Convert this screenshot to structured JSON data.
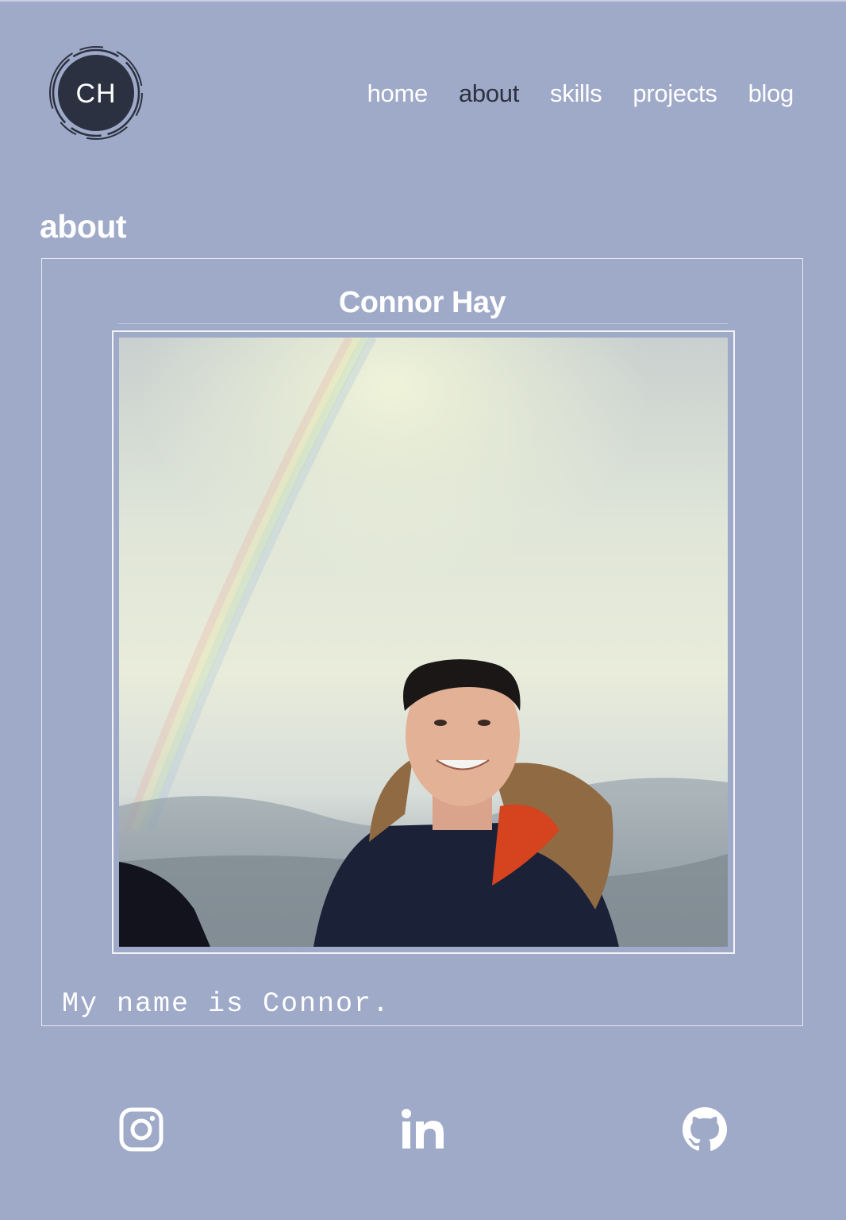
{
  "logo": {
    "text": "CH",
    "icon": "ch-monogram-logo"
  },
  "nav": {
    "items": [
      {
        "label": "home",
        "active": false
      },
      {
        "label": "about",
        "active": true
      },
      {
        "label": "skills",
        "active": false
      },
      {
        "label": "projects",
        "active": false
      },
      {
        "label": "blog",
        "active": false
      }
    ]
  },
  "section": {
    "title": "about"
  },
  "card": {
    "name": "Connor Hay",
    "photo": "portrait-photo",
    "bio": "My name is Connor."
  },
  "social": [
    {
      "icon": "instagram-icon"
    },
    {
      "icon": "linkedin-icon"
    },
    {
      "icon": "github-icon"
    }
  ],
  "colors": {
    "background": "#9fa9c8",
    "text": "#ffffff",
    "active_nav": "#2d3240",
    "logo_fill": "#2b3140"
  }
}
